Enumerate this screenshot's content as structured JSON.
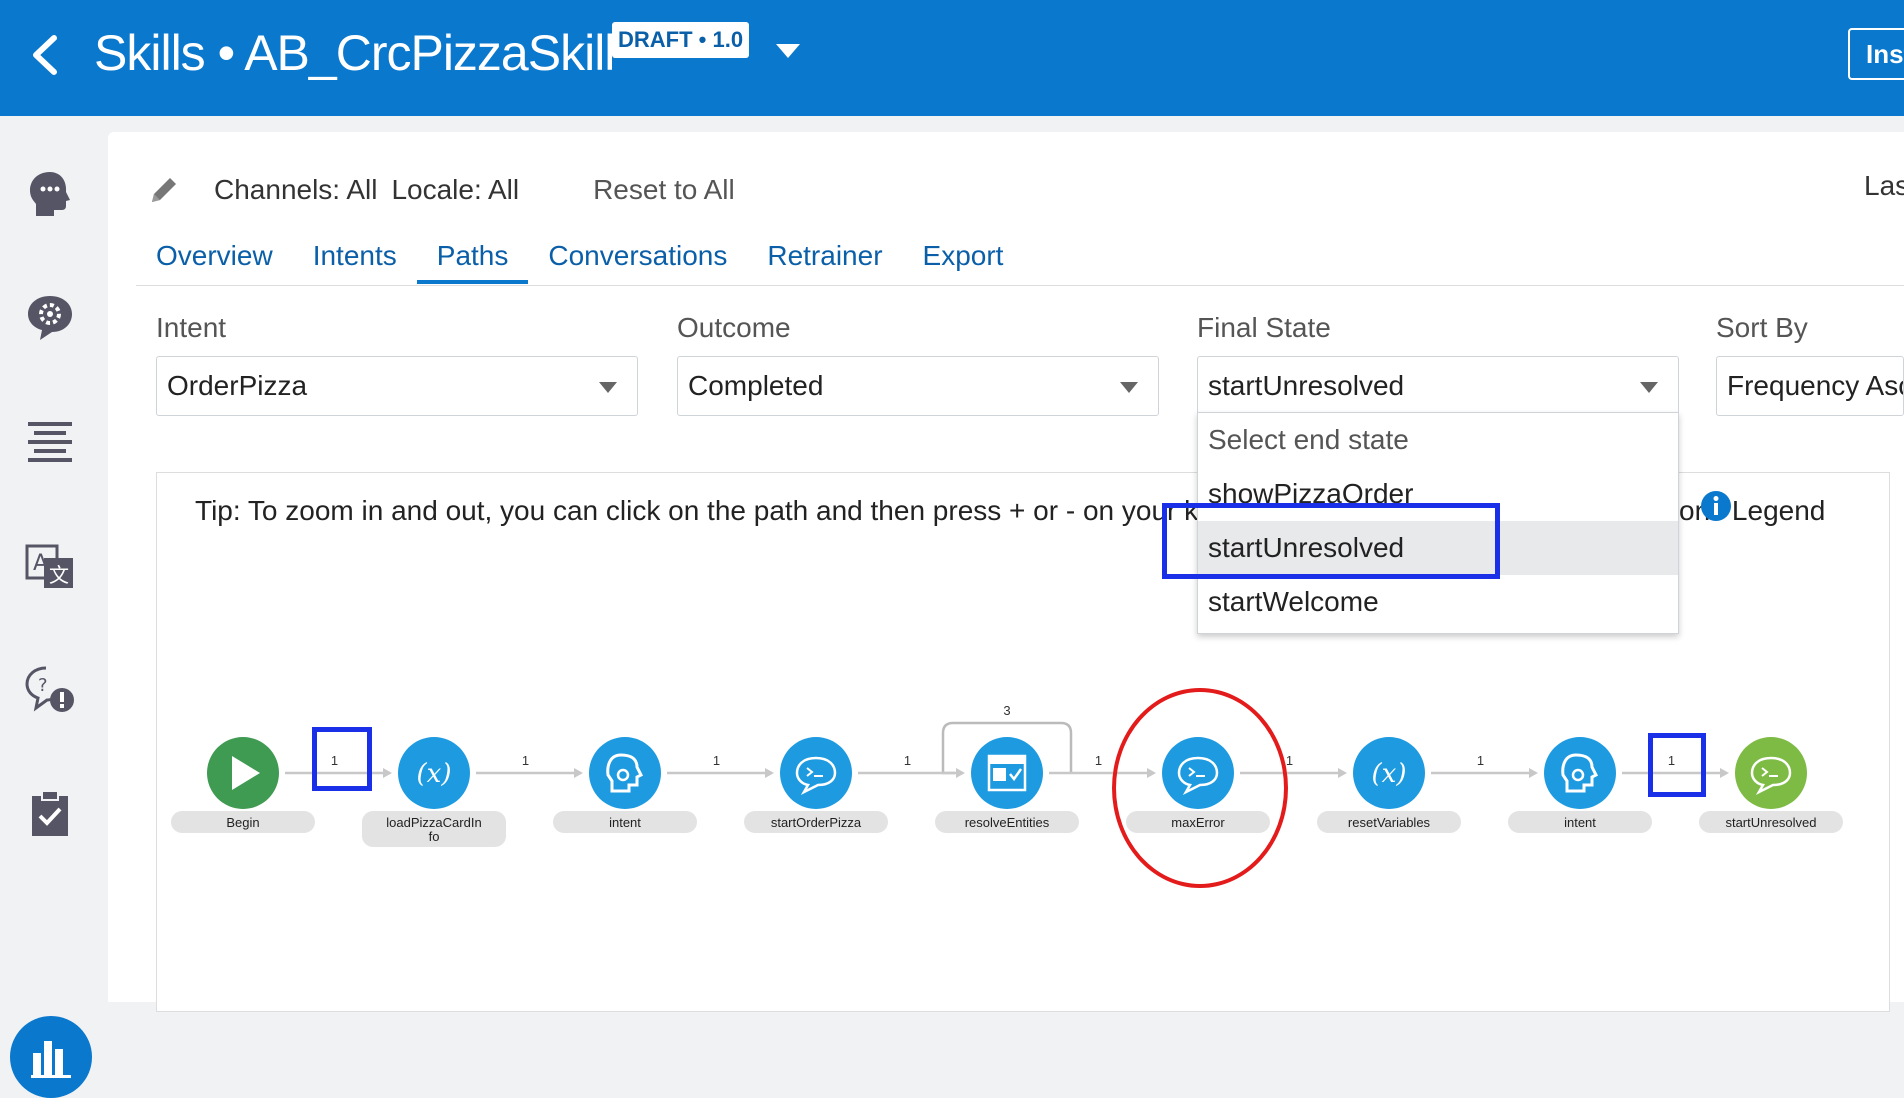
{
  "header": {
    "title": "Skills • AB_CrcPizzaSkill",
    "badge": "DRAFT • 1.0",
    "install_button": "Inst"
  },
  "sidebar": {
    "items": [
      "intents-icon",
      "settings-chat-icon",
      "flows-icon",
      "translate-icon",
      "help-chat-icon",
      "checklist-icon",
      "insights-icon"
    ],
    "active": "insights-icon"
  },
  "filters": {
    "channels": "Channels: All",
    "locale": "Locale: All",
    "reset": "Reset to All",
    "last": "Las"
  },
  "tabs": [
    {
      "label": "Overview"
    },
    {
      "label": "Intents"
    },
    {
      "label": "Paths",
      "active": true
    },
    {
      "label": "Conversations"
    },
    {
      "label": "Retrainer"
    },
    {
      "label": "Export"
    }
  ],
  "fields": {
    "intent": {
      "label": "Intent",
      "value": "OrderPizza"
    },
    "outcome": {
      "label": "Outcome",
      "value": "Completed"
    },
    "final_state": {
      "label": "Final State",
      "value": "startUnresolved"
    },
    "sort_by": {
      "label": "Sort By",
      "value": "Frequency Asc"
    }
  },
  "dropdown": {
    "placeholder": "Select end state",
    "options": [
      "showPizzaOrder",
      "startUnresolved",
      "startWelcome"
    ],
    "selected": "startUnresolved"
  },
  "canvas": {
    "tip": "Tip: To zoom in and out, you can click on the path and then press + or - on your k",
    "legend": "ons Legend"
  },
  "path": {
    "nodes": [
      {
        "label": "Begin",
        "icon": "play-icon",
        "color": "#3f9a52"
      },
      {
        "label": "loadPizzaCardIn\nfo",
        "icon": "variable-icon",
        "color": "#1e9be0"
      },
      {
        "label": "intent",
        "icon": "intent-head-icon",
        "color": "#1e9be0"
      },
      {
        "label": "startOrderPizza",
        "icon": "chat-icon",
        "color": "#1e9be0"
      },
      {
        "label": "resolveEntities",
        "icon": "form-icon",
        "color": "#1e9be0"
      },
      {
        "label": "maxError",
        "icon": "chat-icon",
        "color": "#1e9be0"
      },
      {
        "label": "resetVariables",
        "icon": "reset-variable-icon",
        "color": "#1e9be0"
      },
      {
        "label": "intent",
        "icon": "intent-head-icon",
        "color": "#1e9be0"
      },
      {
        "label": "startUnresolved",
        "icon": "chat-icon",
        "color": "#7dbb44"
      }
    ],
    "edge_counts": [
      "1",
      "1",
      "1",
      "1",
      "1",
      "1",
      "1",
      "1"
    ],
    "loop_count": "3"
  }
}
